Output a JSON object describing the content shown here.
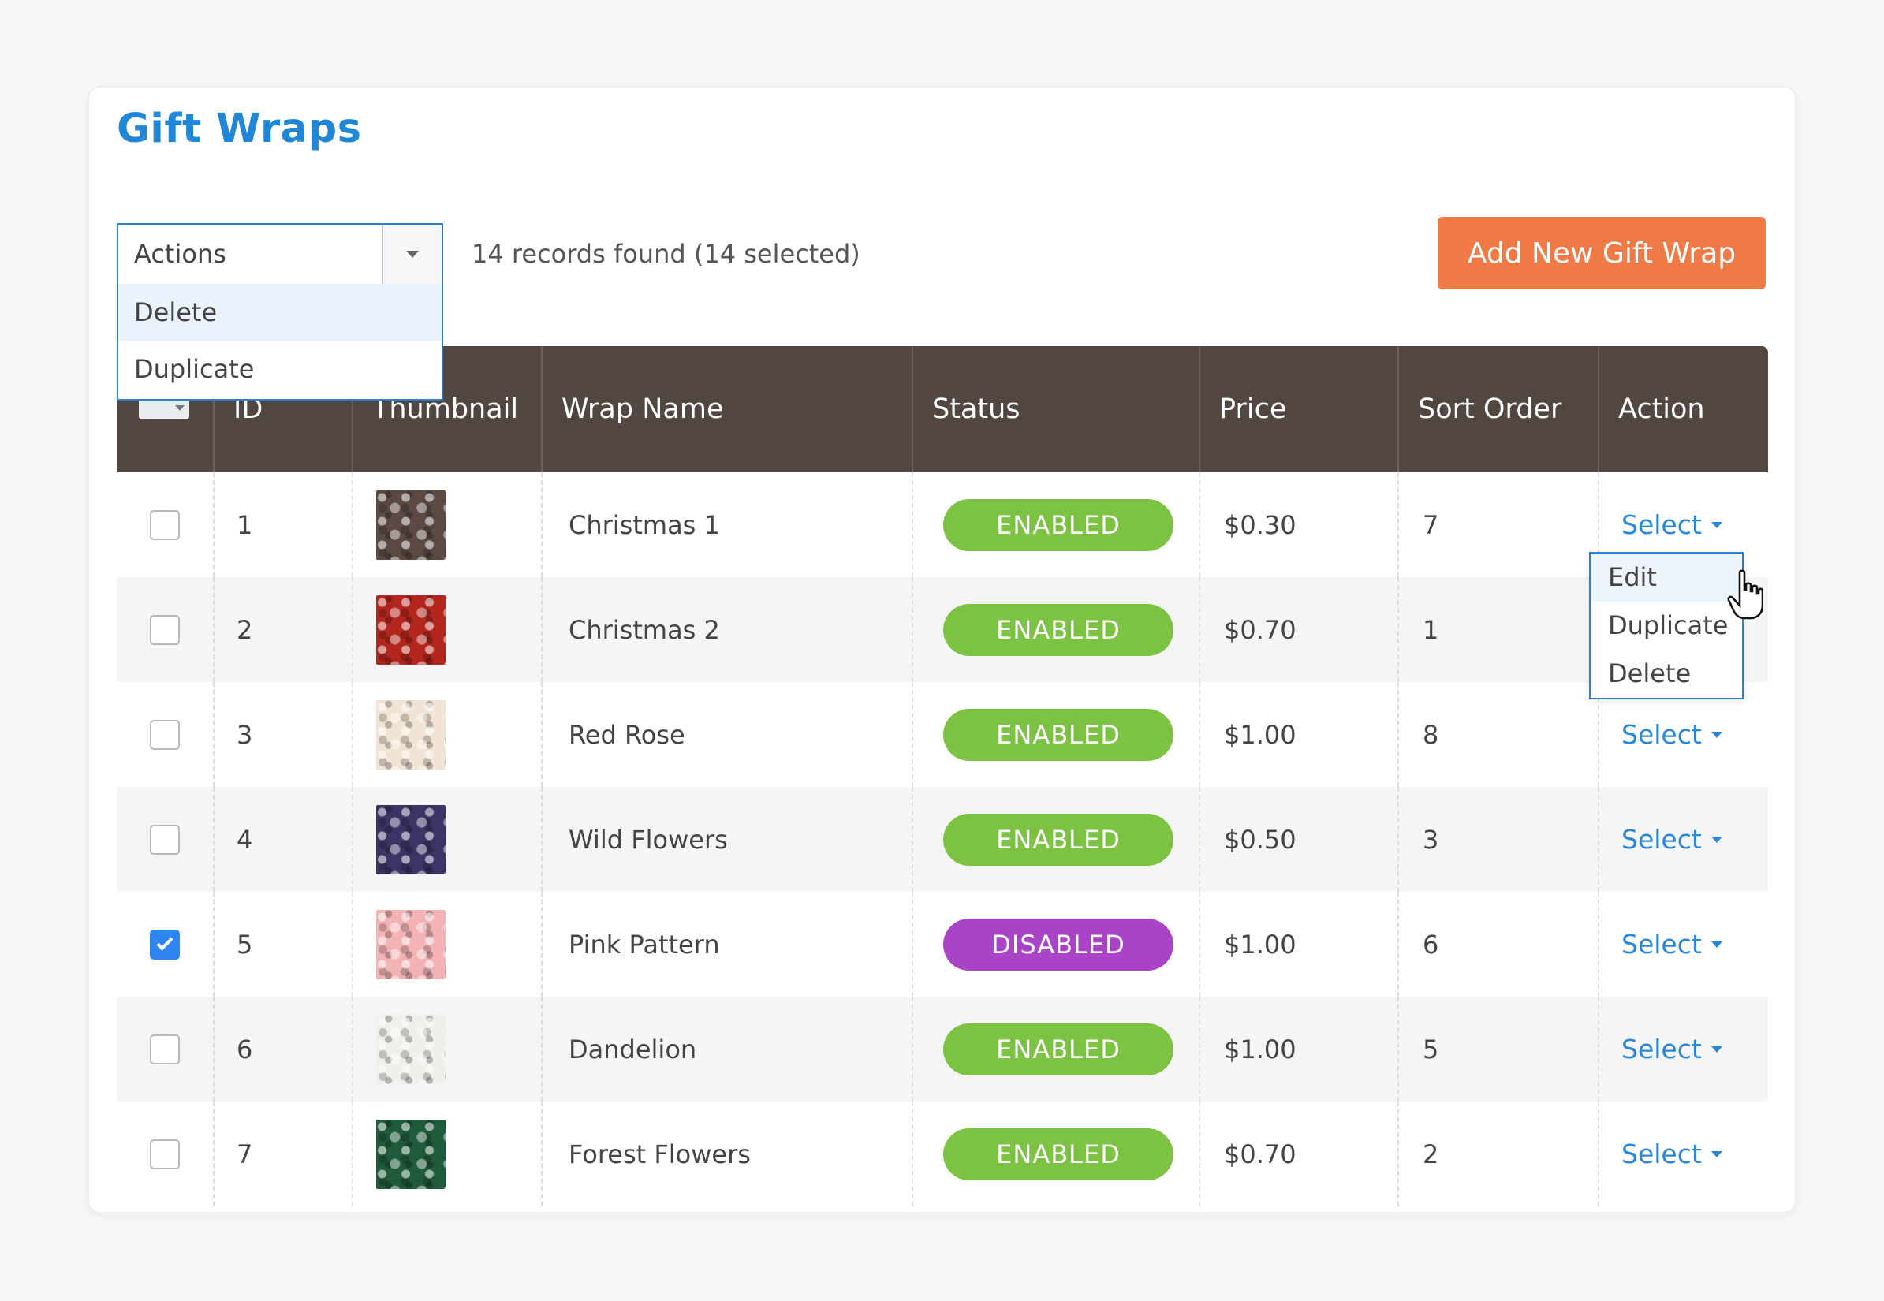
{
  "page": {
    "title": "Gift Wraps"
  },
  "toolbar": {
    "actions_label": "Actions",
    "actions_options": [
      "Delete",
      "Duplicate"
    ],
    "records_text": "14 records found (14 selected)",
    "add_button": "Add New Gift Wrap"
  },
  "table": {
    "columns": [
      "ID",
      "Thumbnail",
      "Wrap Name",
      "Status",
      "Price",
      "Sort Order",
      "Action"
    ],
    "rows": [
      {
        "checked": false,
        "id": "1",
        "thumb": "christmas-pattern",
        "thumb_color": "#5b4a44",
        "name": "Christmas 1",
        "status": "ENABLED",
        "price": "$0.30",
        "sort": "7",
        "action": "Select"
      },
      {
        "checked": false,
        "id": "2",
        "thumb": "christmas-red-pattern",
        "thumb_color": "#b3261e",
        "name": "Christmas 2",
        "status": "ENABLED",
        "price": "$0.70",
        "sort": "1",
        "action": "Select"
      },
      {
        "checked": false,
        "id": "3",
        "thumb": "red-rose-pattern",
        "thumb_color": "#f2e4d4",
        "name": "Red Rose",
        "status": "ENABLED",
        "price": "$1.00",
        "sort": "8",
        "action": "Select"
      },
      {
        "checked": false,
        "id": "4",
        "thumb": "wild-flowers-pattern",
        "thumb_color": "#3b3566",
        "name": "Wild Flowers",
        "status": "ENABLED",
        "price": "$0.50",
        "sort": "3",
        "action": "Select"
      },
      {
        "checked": true,
        "id": "5",
        "thumb": "pink-pattern",
        "thumb_color": "#f3b3b5",
        "name": "Pink Pattern",
        "status": "DISABLED",
        "price": "$1.00",
        "sort": "6",
        "action": "Select"
      },
      {
        "checked": false,
        "id": "6",
        "thumb": "dandelion-pattern",
        "thumb_color": "#eef0ec",
        "name": "Dandelion",
        "status": "ENABLED",
        "price": "$1.00",
        "sort": "5",
        "action": "Select"
      },
      {
        "checked": false,
        "id": "7",
        "thumb": "forest-flowers-pattern",
        "thumb_color": "#1f5a3a",
        "name": "Forest Flowers",
        "status": "ENABLED",
        "price": "$0.70",
        "sort": "2",
        "action": "Select"
      }
    ]
  },
  "row_action_menu": {
    "options": [
      "Edit",
      "Duplicate",
      "Delete"
    ]
  },
  "colors": {
    "title": "#1f87d6",
    "header_bg": "#524740",
    "enabled": "#7cc243",
    "disabled": "#a944c6",
    "add_button": "#f07a45",
    "link": "#2b87d6"
  }
}
